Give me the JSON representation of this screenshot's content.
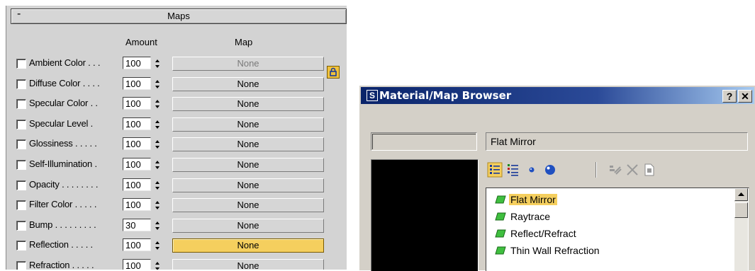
{
  "maps_rollout": {
    "collapse_symbol": "-",
    "title": "Maps",
    "amount_header": "Amount",
    "map_header": "Map",
    "rows": [
      {
        "label": "Ambient Color . . .",
        "amount": "100",
        "map": "None",
        "enabled": false
      },
      {
        "label": "Diffuse Color . . . .",
        "amount": "100",
        "map": "None",
        "enabled": true
      },
      {
        "label": "Specular Color . .",
        "amount": "100",
        "map": "None",
        "enabled": true
      },
      {
        "label": "Specular Level .",
        "amount": "100",
        "map": "None",
        "enabled": true
      },
      {
        "label": "Glossiness . . . . .",
        "amount": "100",
        "map": "None",
        "enabled": true
      },
      {
        "label": "Self-Illumination .",
        "amount": "100",
        "map": "None",
        "enabled": true
      },
      {
        "label": "Opacity . . . . . . . .",
        "amount": "100",
        "map": "None",
        "enabled": true
      },
      {
        "label": "Filter Color . . . . .",
        "amount": "100",
        "map": "None",
        "enabled": true
      },
      {
        "label": "Bump . . . . . . . . .",
        "amount": "30",
        "map": "None",
        "enabled": true
      },
      {
        "label": "Reflection . . . . .",
        "amount": "100",
        "map": "None",
        "enabled": true,
        "active": true
      },
      {
        "label": "Refraction . . . . .",
        "amount": "100",
        "map": "None",
        "enabled": true
      }
    ],
    "lock_icon": "lock-icon",
    "active_color": "#f5cf5e"
  },
  "browser": {
    "app_icon_letter": "S",
    "title": "Material/Map Browser",
    "help_button": "?",
    "close_button": "✕",
    "name_field": "Flat Mirror",
    "toolbar_icons": [
      "view-list-icon",
      "view-list-icons-icon",
      "small-icons-icon",
      "large-icons-icon",
      "update-scene-icon",
      "delete-icon",
      "clear-icon"
    ],
    "list_items": [
      {
        "label": "Flat Mirror",
        "selected": true
      },
      {
        "label": "Raytrace",
        "selected": false
      },
      {
        "label": "Reflect/Refract",
        "selected": false
      },
      {
        "label": "Thin Wall Refraction",
        "selected": false
      }
    ],
    "title_bar_color": "#0a246a",
    "selected_color": "#f5cf5e"
  }
}
